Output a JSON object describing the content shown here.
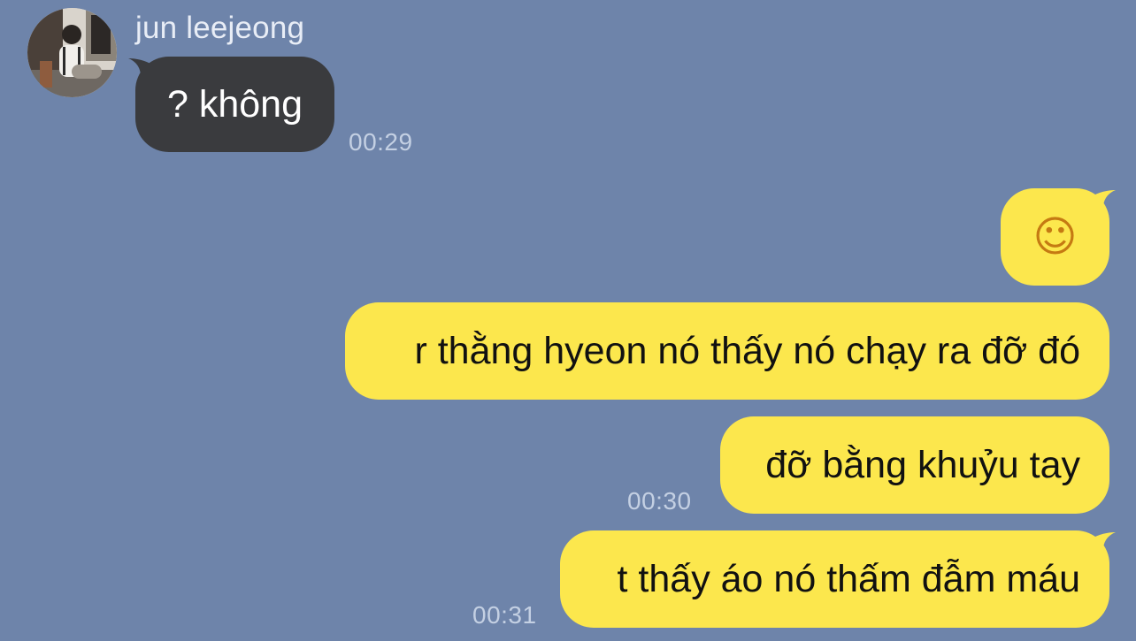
{
  "chat": {
    "incoming": {
      "sender_name": "jun leejeong",
      "message": "? không",
      "time": "00:29"
    },
    "outgoing": [
      {
        "text": "☺",
        "time": ""
      },
      {
        "text": "r thằng hyeon nó thấy nó chạy ra đỡ đó",
        "time": ""
      },
      {
        "text": "đỡ bằng khuỷu tay",
        "time": "00:30"
      },
      {
        "text": "t thấy áo nó thấm đẫm máu",
        "time": "00:31"
      }
    ]
  },
  "colors": {
    "background": "#6e84aa",
    "incoming_bubble": "#3a3b3e",
    "outgoing_bubble": "#fce74d",
    "timestamp": "#c4d0e3"
  },
  "icons": {
    "emoji": "smiling-face-emoji",
    "avatar": "user-avatar-photo"
  }
}
